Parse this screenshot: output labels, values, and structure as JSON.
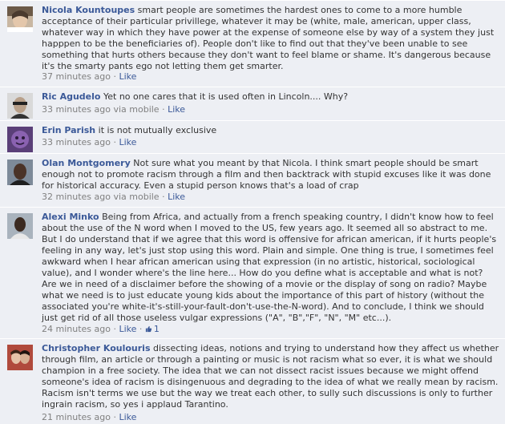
{
  "comments": [
    {
      "name": "Nicola Kountoupes",
      "text": "smart people are sometimes the hardest ones to come to a more humble acceptance of their particular privillege, whatever it may be (white, male, american, upper class, whatever way in which they have power at the expense of someone else by way of a system they just happpen to be the beneficiaries of). People don't like to find out that they've been unable to see something that hurts others because they don't want to feel blame or shame. It's dangerous because it's the smarty pants ego not letting them get smarter.",
      "time": "37 minutes ago",
      "sep": "·",
      "like": "Like"
    },
    {
      "name": "Ric Agudelo",
      "text": "Yet no one cares that it is used often in Lincoln.... Why?",
      "time": "33 minutes ago via mobile",
      "sep": "·",
      "like": "Like"
    },
    {
      "name": "Erin Parish",
      "text": "it is not mutually exclusive",
      "time": "33 minutes ago",
      "sep": "·",
      "like": "Like"
    },
    {
      "name": "Olan Montgomery",
      "text": "Not sure what you meant by that Nicola. I think smart people should be smart enough not to promote racism through a film and then backtrack with stupid excuses like it was done for historical accuracy. Even a stupid person knows that's a load of crap",
      "time": "32 minutes ago via mobile",
      "sep": "·",
      "like": "Like"
    },
    {
      "name": "Alexi Minko",
      "text": "Being from Africa, and actually from a french speaking country, I didn't know how to feel about the use of the N word when I moved to the US, few years ago. It seemed all so abstract to me. But I do understand that if we agree that this word is offensive for african american, if it hurts people's feeling in any way, let's just stop using this word. Plain and simple. One thing is true, I sometimes feel awkward when I hear african american using that expression (in no artistic, historical, sociological value), and I wonder where's the line here... How do you define what is acceptable and what is not? Are we in need of a disclaimer before the showing of a movie or the display of song on radio? Maybe what we need is to just educate young kids about the importance of this part of history (without the associated you're white-it's-still-your-fault-don't-use-the-N-word). And to conclude, I think we should just get rid of all those useless vulgar expressions (\"A\", \"B\",\"F\", \"N\", \"M\" etc...).",
      "time": "24 minutes ago",
      "sep": "·",
      "like": "Like",
      "like_count": "1"
    },
    {
      "name": "Christopher Koulouris",
      "text": "dissecting ideas, notions and trying to understand how they affect us whether through film, an article or through a painting or music is not racism what so ever, it is what we should champion in a free society. The idea that we can not dissect racist issues because we might offend someone's idea of racism is disingenuous and degrading to the idea of what we really mean by racism. Racism isn't terms we use but the way we treat each other, to sully such discussions is only to further ingrain racism, so yes i applaud Tarantino.",
      "time": "21 minutes ago",
      "sep": "·",
      "like": "Like"
    }
  ]
}
